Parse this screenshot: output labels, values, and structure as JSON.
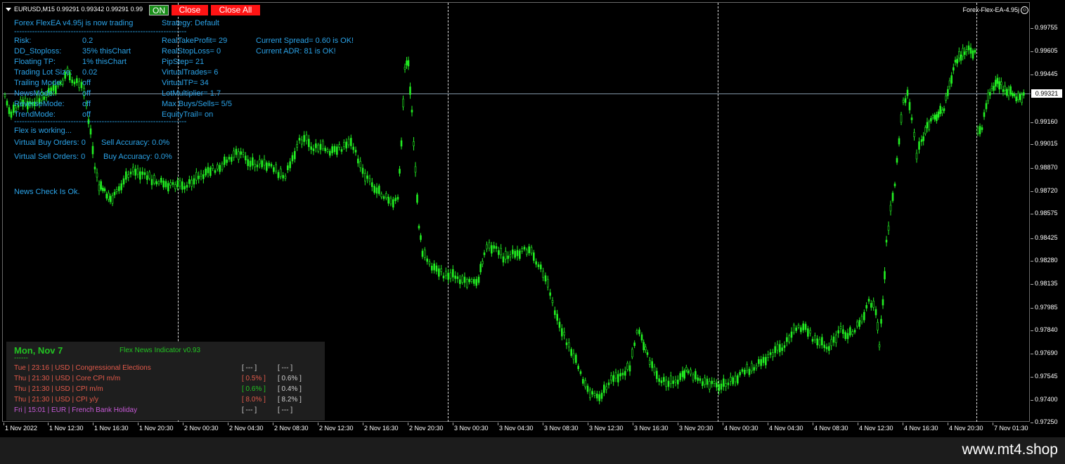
{
  "symbol_info": "EURUSD,M15  0.99291 0.99342 0.99291 0.99",
  "buttons": {
    "on": "ON",
    "close": "Close",
    "close_all": "Close All"
  },
  "ea_name": "Forex-Flex-EA-4.95j",
  "current_price": "0.99321",
  "price_labels": [
    "0.99755",
    "0.99605",
    "0.99445",
    "0.99321",
    "0.99160",
    "0.99015",
    "0.98870",
    "0.98720",
    "0.98575",
    "0.98425",
    "0.98280",
    "0.98135",
    "0.97985",
    "0.97840",
    "0.97690",
    "0.97545",
    "0.97400",
    "0.97250"
  ],
  "time_labels": [
    "1 Nov 2022",
    "1 Nov 12:30",
    "1 Nov 16:30",
    "1 Nov 20:30",
    "2 Nov 00:30",
    "2 Nov 04:30",
    "2 Nov 08:30",
    "2 Nov 12:30",
    "2 Nov 16:30",
    "2 Nov 20:30",
    "3 Nov 00:30",
    "3 Nov 04:30",
    "3 Nov 08:30",
    "3 Nov 12:30",
    "3 Nov 16:30",
    "3 Nov 20:30",
    "4 Nov 00:30",
    "4 Nov 04:30",
    "4 Nov 08:30",
    "4 Nov 12:30",
    "4 Nov 16:30",
    "4 Nov 20:30",
    "7 Nov 01:30"
  ],
  "ea_panel": {
    "status": "Forex FlexEA v4.95j is now trading",
    "strategy": "Strategy: Default",
    "separator": "-------------------------------------------------------------------",
    "risk_label": "Risk:",
    "risk_value": "0.2",
    "dd_label": "DD_Stoploss:",
    "dd_value": "35%  thisChart",
    "ftp_label": "Floating TP:",
    "ftp_value": "1%  thisChart",
    "lot_label": "Trading Lot Size:",
    "lot_value": "0.02",
    "trailing_label": "Trailing Mode:",
    "trailing_value": "off",
    "news_label": "NewsMode:",
    "news_value": "off",
    "reverse_label": "ReverseMode:",
    "reverse_value": "off",
    "trend_label": "TrendMode:",
    "trend_value": "off",
    "real_tp": "RealTakeProfit= 29",
    "real_sl": "RealStopLoss= 0",
    "pipstep": "PipStep= 21",
    "virtual_trades": "VirtualTrades= 6",
    "virtual_tp": "VirtualTP= 34",
    "lot_multiplier": "LotMultiplier= 1.7",
    "max_buys_sells": "Max Buys/Sells= 5/5",
    "equity_trail": "EquityTrail= on",
    "spread": "Current Spread= 0.60 is OK!",
    "adr": "Current ADR: 81  is OK!",
    "working": "Flex is working...",
    "virtual_buy": "Virtual Buy Orders: 0",
    "sell_accuracy": "Sell Accuracy: 0.0%",
    "virtual_sell": "Virtual Sell Orders: 0",
    "buy_accuracy": "Buy Accuracy: 0.0%",
    "news_check": "News Check Is Ok."
  },
  "news_panel": {
    "date": "Mon, Nov 7",
    "title": "Flex News Indicator v0.93",
    "separator": "------",
    "rows": [
      {
        "text": "Tue  |  23:16  |  USD  |  Congressional Elections",
        "v1": "[ --- ]",
        "v2": "[ --- ]",
        "color": "#e35a4a",
        "v1color": "#cfcfcf"
      },
      {
        "text": "Thu  |  21:30  |  USD  |  Core CPI m/m",
        "v1": "[ 0.5% ]",
        "v2": "[ 0.6% ]",
        "color": "#e35a4a",
        "v1color": "#e35a4a"
      },
      {
        "text": "Thu  |  21:30  |  USD  |  CPI m/m",
        "v1": "[ 0.6% ]",
        "v2": "[ 0.4% ]",
        "color": "#e35a4a",
        "v1color": "#22c322"
      },
      {
        "text": "Thu  |  21:30  |  USD  |  CPI y/y",
        "v1": "[ 8.0% ]",
        "v2": "[ 8.2% ]",
        "color": "#e35a4a",
        "v1color": "#e35a4a"
      },
      {
        "text": "Fri  |  15:01  |  EUR  |  French Bank Holiday",
        "v1": "[ --- ]",
        "v2": "[ --- ]",
        "color": "#c85ad8",
        "v1color": "#cfcfcf"
      }
    ]
  },
  "footer_url": "www.mt4.shop",
  "colors": {
    "candle": "#22ee22",
    "ea_text": "#2ba3e8",
    "button_red": "#ff1414",
    "button_green": "#1a8f1a"
  }
}
